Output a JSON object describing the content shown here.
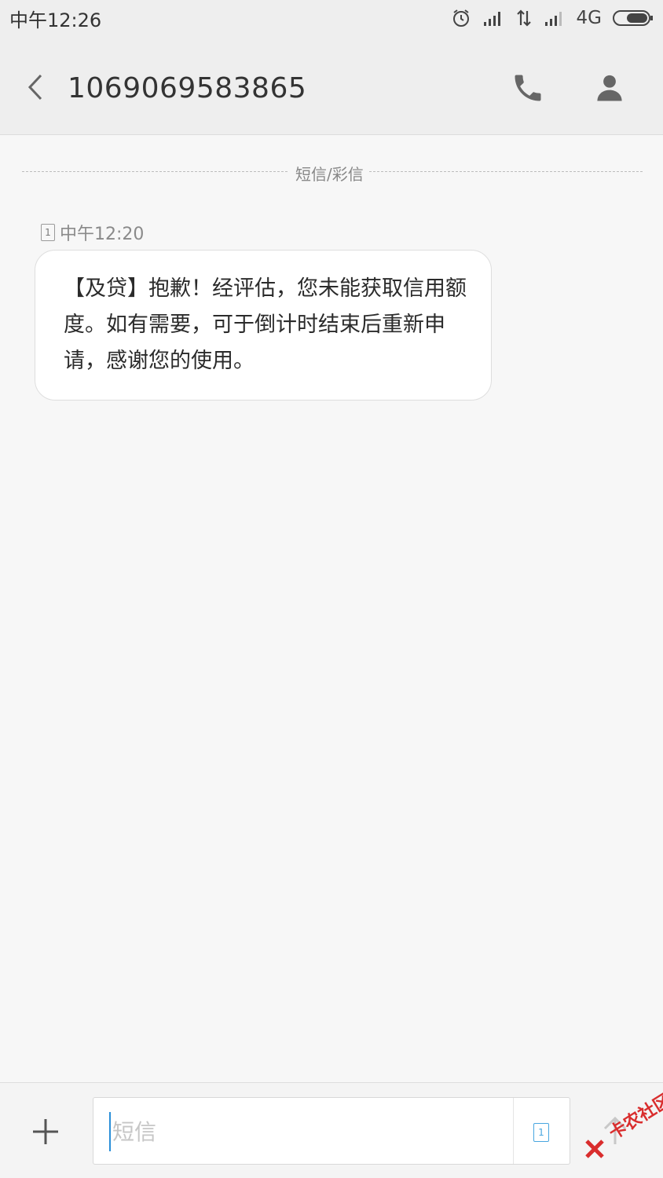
{
  "status_bar": {
    "time": "中午12:26",
    "network": "4G",
    "icons": [
      "alarm-icon",
      "signal-icon",
      "data-transfer-icon",
      "signal-icon",
      "battery-icon"
    ]
  },
  "header": {
    "contact_number": "1069069583865",
    "icons": [
      "back-arrow-icon",
      "phone-icon",
      "person-icon"
    ]
  },
  "thread": {
    "divider_label": "短信/彩信",
    "messages": [
      {
        "sim": "1",
        "time": "中午12:20",
        "text": "【及贷】抱歉！经评估，您未能获取信用额度。如有需要，可于倒计时结束后重新申请，感谢您的使用。"
      }
    ]
  },
  "composer": {
    "placeholder": "短信",
    "sim": "1",
    "icons": [
      "plus-icon",
      "sim-card-icon",
      "send-arrow-icon"
    ]
  },
  "watermark": {
    "text": "卡农社区"
  },
  "colors": {
    "accent": "#2a8fd8",
    "background": "#f7f7f7",
    "header": "#eeeeee",
    "bubble": "#ffffff"
  }
}
